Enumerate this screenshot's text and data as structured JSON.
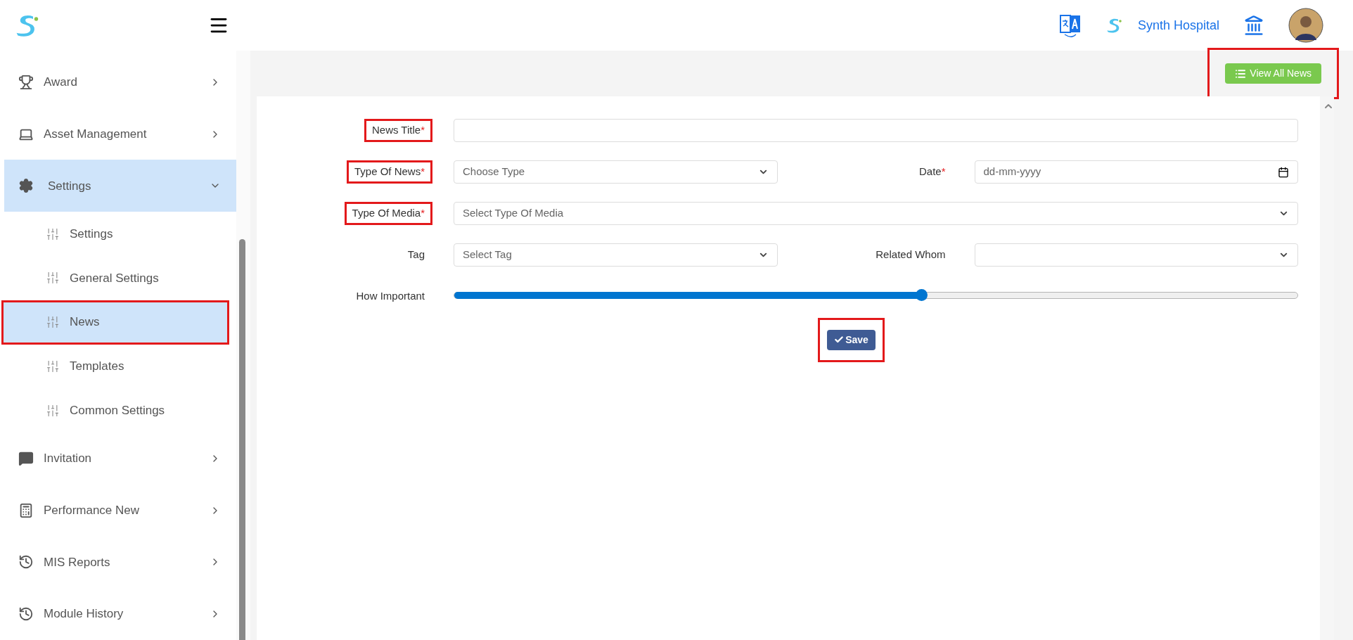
{
  "header": {
    "brand": "Synth Hospital"
  },
  "sidebar": {
    "items": [
      {
        "label": "Award",
        "expanded": false
      },
      {
        "label": "Asset Management",
        "expanded": false
      },
      {
        "label": "Settings",
        "expanded": true,
        "children": [
          {
            "label": "Settings",
            "selected": false,
            "highlighted": false
          },
          {
            "label": "General Settings",
            "selected": false,
            "highlighted": false
          },
          {
            "label": "News",
            "selected": true,
            "highlighted": true
          },
          {
            "label": "Templates",
            "selected": false,
            "highlighted": false
          },
          {
            "label": "Common Settings",
            "selected": false,
            "highlighted": false
          }
        ]
      },
      {
        "label": "Invitation",
        "expanded": false
      },
      {
        "label": "Performance New",
        "expanded": false
      },
      {
        "label": "MIS Reports",
        "expanded": false
      },
      {
        "label": "Module History",
        "expanded": false
      }
    ]
  },
  "toolbar": {
    "view_all_button": {
      "label": "View All News",
      "highlighted": true
    }
  },
  "form": {
    "rows": [
      {
        "fields": [
          {
            "kind": "text",
            "label": "News Title",
            "required_mark": "*",
            "highlighted": true
          }
        ]
      },
      {
        "fields": [
          {
            "kind": "select",
            "label": "Type Of News",
            "required_mark": "*",
            "highlighted": true,
            "placeholder": "Choose Type"
          },
          {
            "kind": "date",
            "label": "Date",
            "required_mark": "*",
            "highlighted": false,
            "placeholder": "dd-mm-yyyy"
          }
        ]
      },
      {
        "fields": [
          {
            "kind": "select",
            "label": "Type Of Media",
            "required_mark": "*",
            "highlighted": true,
            "placeholder": "Select Type Of Media"
          }
        ]
      },
      {
        "fields": [
          {
            "kind": "select",
            "label": "Tag",
            "highlighted": false,
            "placeholder": "Select Tag"
          },
          {
            "kind": "select",
            "label": "Related Whom",
            "highlighted": false
          }
        ]
      },
      {
        "fields": [
          {
            "kind": "slider",
            "label": "How Important",
            "highlighted": false,
            "level": 0.554
          }
        ]
      }
    ],
    "save_button": {
      "label": "Save",
      "highlighted": true
    }
  }
}
